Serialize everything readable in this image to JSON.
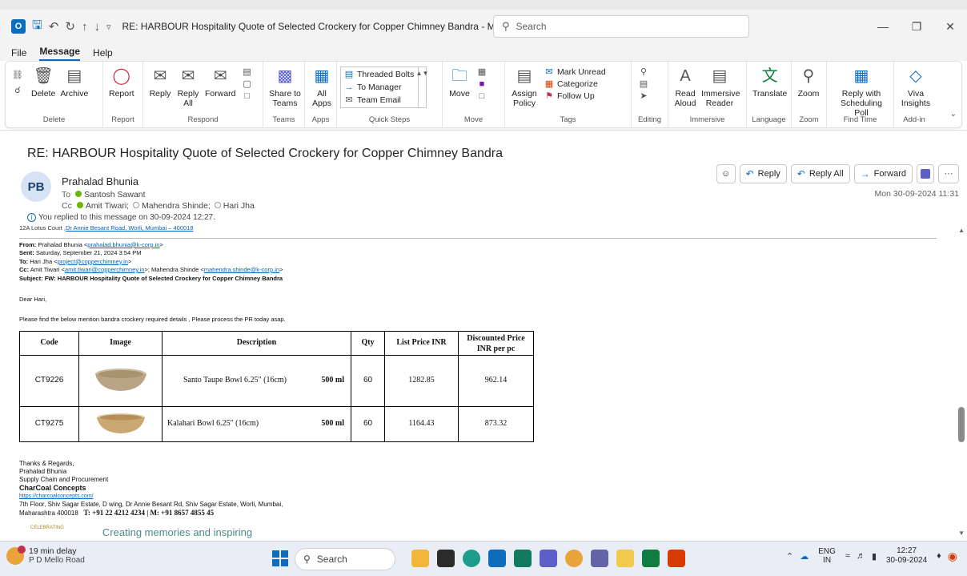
{
  "window": {
    "title": "RE: HARBOUR Hospitality Quote of Selected Crockery for Copper Chimney Bandra  -  Message (HT...",
    "search_placeholder": "Search",
    "qat_dropdown": "▿"
  },
  "menu": {
    "tabs": [
      "File",
      "Message",
      "Help"
    ]
  },
  "ribbon": {
    "delete": {
      "delete_label": "Delete",
      "archive_label": "Archive",
      "group": "Delete"
    },
    "report": {
      "label": "Report",
      "group": "Report"
    },
    "respond": {
      "reply": "Reply",
      "reply_all": "Reply All",
      "forward": "Forward",
      "group": "Respond"
    },
    "teams": {
      "label": "Share to Teams",
      "group": "Teams"
    },
    "apps": {
      "label": "All Apps",
      "group": "Apps"
    },
    "quicksteps": {
      "items": [
        "Threaded Bolts",
        "To Manager",
        "Team Email"
      ],
      "group": "Quick Steps"
    },
    "move": {
      "label": "Move",
      "group": "Move"
    },
    "tags": {
      "assign_policy": "Assign Policy",
      "mark_unread": "Mark Unread",
      "categorize": "Categorize",
      "follow_up": "Follow Up",
      "group": "Tags"
    },
    "editing": {
      "group": "Editing"
    },
    "immersive": {
      "read_aloud": "Read Aloud",
      "immersive_reader": "Immersive Reader",
      "group": "Immersive"
    },
    "language": {
      "translate": "Translate",
      "group": "Language"
    },
    "zoom": {
      "label": "Zoom",
      "group": "Zoom"
    },
    "findtime": {
      "label": "Reply with Scheduling Poll",
      "group": "Find Time"
    },
    "addin": {
      "label": "Viva Insights",
      "group": "Add-in"
    }
  },
  "message": {
    "subject": "RE: HARBOUR Hospitality Quote of Selected Crockery for Copper Chimney Bandra",
    "avatar_initials": "PB",
    "sender": "Prahalad Bhunia",
    "to_label": "To",
    "to": "Santosh Sawant",
    "cc_label": "Cc",
    "cc": [
      "Amit Tiwari;",
      "Mahendra Shinde;",
      "Hari Jha"
    ],
    "replied_note": "You replied to this message on 30-09-2024 12:27.",
    "date": "Mon 30-09-2024 11:31",
    "actions": {
      "reply": "Reply",
      "reply_all": "Reply All",
      "forward": "Forward",
      "more": "···"
    }
  },
  "body": {
    "cut_line_text": "12A Lotus Court ,",
    "cut_line_link": "Dr Annie Besant Road, Worli, Mumbai – 400018",
    "from_label": "From:",
    "from_name": "Prahalad Bhunia <",
    "from_email": "prahalad.bhunia@k-corp.in",
    "from_close": ">",
    "sent_label": "Sent:",
    "sent": "Saturday, September 21, 2024 3:54 PM",
    "to_label": "To:",
    "to_name": "Hari Jha <",
    "to_email": "project@copperchimney.in",
    "to_close": ">",
    "cc_label": "Cc:",
    "cc_name1": "Amit Tiwari <",
    "cc_email1": "amit.tiwari@copperchimney.in",
    "cc_mid": ">; Mahendra Shinde <",
    "cc_email2": "mahendra.shinde@k-corp.in",
    "cc_close": ">",
    "subject_label": "Subject:",
    "subject": "FW: HARBOUR Hospitality Quote of Selected Crockery for Copper Chimney Bandra",
    "greeting": "Dear Hari,",
    "intro": "Please find the below mention bandra crockery required details , Please process the PR today asap.",
    "table": {
      "headers": [
        "Code",
        "Image",
        "Description",
        "Qty",
        "List Price INR",
        "Discounted Price INR per pc"
      ],
      "rows": [
        {
          "code": "CT9226",
          "desc": "Santo Taupe Bowl  6.25\" (16cm)",
          "vol": "500 ml",
          "qty": "60",
          "list": "1282.85",
          "disc": "962.14"
        },
        {
          "code": "CT9275",
          "desc": "Kalahari Bowl 6.25\" (16cm)",
          "vol": "500 ml",
          "qty": "60",
          "list": "1164.43",
          "disc": "873.32"
        }
      ]
    },
    "signature": {
      "regards": "Thanks & Regards,",
      "name": "Prahalad Bhunia",
      "title": "Supply Chain and Procurement",
      "company": "CharCoal Concepts",
      "url": "https://charcoalconcepts.com/",
      "address1": "7th Floor, Shiv Sagar Estate, D wing, Dr Annie Besant Rd, Shiv Sagar Estate, Worli, Mumbai,",
      "address2_city": "Maharashtra 400018",
      "address2_phone": "T: +91 22 4212 4234 | M: +91 8657 4855 45",
      "celebrating": "CELEBRATING",
      "tagline": "Creating memories and inspiring"
    }
  },
  "taskbar": {
    "weather_title": "19 min delay",
    "weather_sub": "P D Mello Road",
    "search": "Search",
    "lang1": "ENG",
    "lang2": "IN",
    "time": "12:27",
    "date": "30-09-2024"
  },
  "colors": {
    "accent": "#0f6cbd",
    "presence": "#6bb700"
  }
}
